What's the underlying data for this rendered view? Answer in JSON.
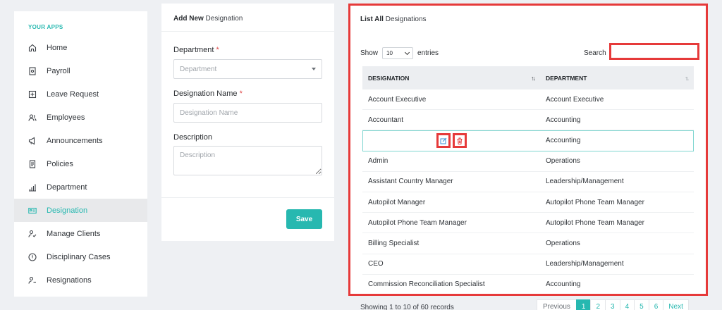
{
  "sidebar": {
    "title": "YOUR APPS",
    "items": [
      {
        "label": "Home",
        "icon": "home-icon"
      },
      {
        "label": "Payroll",
        "icon": "payroll-icon"
      },
      {
        "label": "Leave Request",
        "icon": "leave-request-icon"
      },
      {
        "label": "Employees",
        "icon": "employees-icon"
      },
      {
        "label": "Announcements",
        "icon": "megaphone-icon"
      },
      {
        "label": "Policies",
        "icon": "document-icon"
      },
      {
        "label": "Department",
        "icon": "bar-chart-icon"
      },
      {
        "label": "Designation",
        "icon": "id-card-icon",
        "active": true
      },
      {
        "label": "Manage Clients",
        "icon": "user-check-icon"
      },
      {
        "label": "Disciplinary Cases",
        "icon": "alert-circle-icon"
      },
      {
        "label": "Resignations",
        "icon": "user-minus-icon"
      }
    ]
  },
  "add_form": {
    "header_bold": "Add New",
    "header_rest": " Designation",
    "department_label": "Department",
    "department_placeholder": "Department",
    "name_label": "Designation Name",
    "name_placeholder": "Designation Name",
    "description_label": "Description",
    "description_placeholder": "Description",
    "required_mark": "*",
    "save_label": "Save"
  },
  "list": {
    "header_bold": "List All",
    "header_rest": " Designations",
    "show_label": "Show",
    "entries_value": "10",
    "entries_label": "entries",
    "search_label": "Search",
    "search_value": "",
    "columns": [
      "DESIGNATION",
      "DEPARTMENT"
    ],
    "sort_glyph": "↑↓",
    "rows": [
      {
        "designation": "Account Executive",
        "department": "Account Executive"
      },
      {
        "designation": "Accountant",
        "department": "Accounting"
      },
      {
        "designation": "",
        "department": "Accounting",
        "highlighted": true
      },
      {
        "designation": "Admin",
        "department": "Operations"
      },
      {
        "designation": "Assistant Country Manager",
        "department": "Leadership/Management"
      },
      {
        "designation": "Autopilot Manager",
        "department": "Autopilot Phone Team Manager"
      },
      {
        "designation": "Autopilot Phone Team Manager",
        "department": "Autopilot Phone Team Manager"
      },
      {
        "designation": "Billing Specialist",
        "department": "Operations"
      },
      {
        "designation": "CEO",
        "department": "Leadership/Management"
      },
      {
        "designation": "Commission Reconciliation Specialist",
        "department": "Accounting"
      }
    ]
  },
  "footer": {
    "info": "Showing 1 to 10 of 60 records",
    "previous": "Previous",
    "pages": [
      "1",
      "2",
      "3",
      "4",
      "5",
      "6"
    ],
    "next": "Next"
  },
  "colors": {
    "accent": "#27b8b0",
    "highlight_border": "#e63a3a"
  }
}
